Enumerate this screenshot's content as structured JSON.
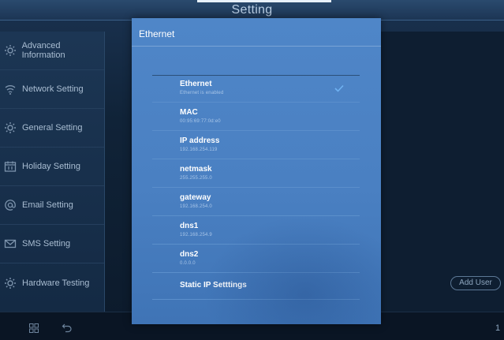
{
  "app": {
    "title": "Setting"
  },
  "sidebar": {
    "items": [
      {
        "label": "Advanced Information",
        "icon": "gear-icon"
      },
      {
        "label": "Network Setting",
        "icon": "wifi-icon"
      },
      {
        "label": "General Setting",
        "icon": "gear-icon"
      },
      {
        "label": "Holiday Setting",
        "icon": "calendar-icon"
      },
      {
        "label": "Email Setting",
        "icon": "at-icon"
      },
      {
        "label": "SMS Setting",
        "icon": "envelope-icon"
      },
      {
        "label": "Hardware Testing",
        "icon": "gear-icon"
      }
    ]
  },
  "right": {
    "add_user_label": "Add User"
  },
  "bottom": {
    "page_number": "1"
  },
  "dialog": {
    "title": "Ethernet",
    "rows": [
      {
        "label": "Ethernet",
        "value": "Ethernet is enabled",
        "checked": true
      },
      {
        "label": "MAC",
        "value": "00:95:69:77:0d:e0"
      },
      {
        "label": "IP address",
        "value": "192.168.254.119"
      },
      {
        "label": "netmask",
        "value": "255.255.255.0"
      },
      {
        "label": "gateway",
        "value": "192.168.254.0"
      },
      {
        "label": "dns1",
        "value": "192.168.254.9"
      },
      {
        "label": "dns2",
        "value": "0.0.0.0"
      }
    ],
    "static_ip_label": "Static IP Setttings"
  },
  "colors": {
    "dialog_bg": "#4f86c8",
    "accent": "#4a90e2",
    "app_bg": "#0d1c2e"
  }
}
